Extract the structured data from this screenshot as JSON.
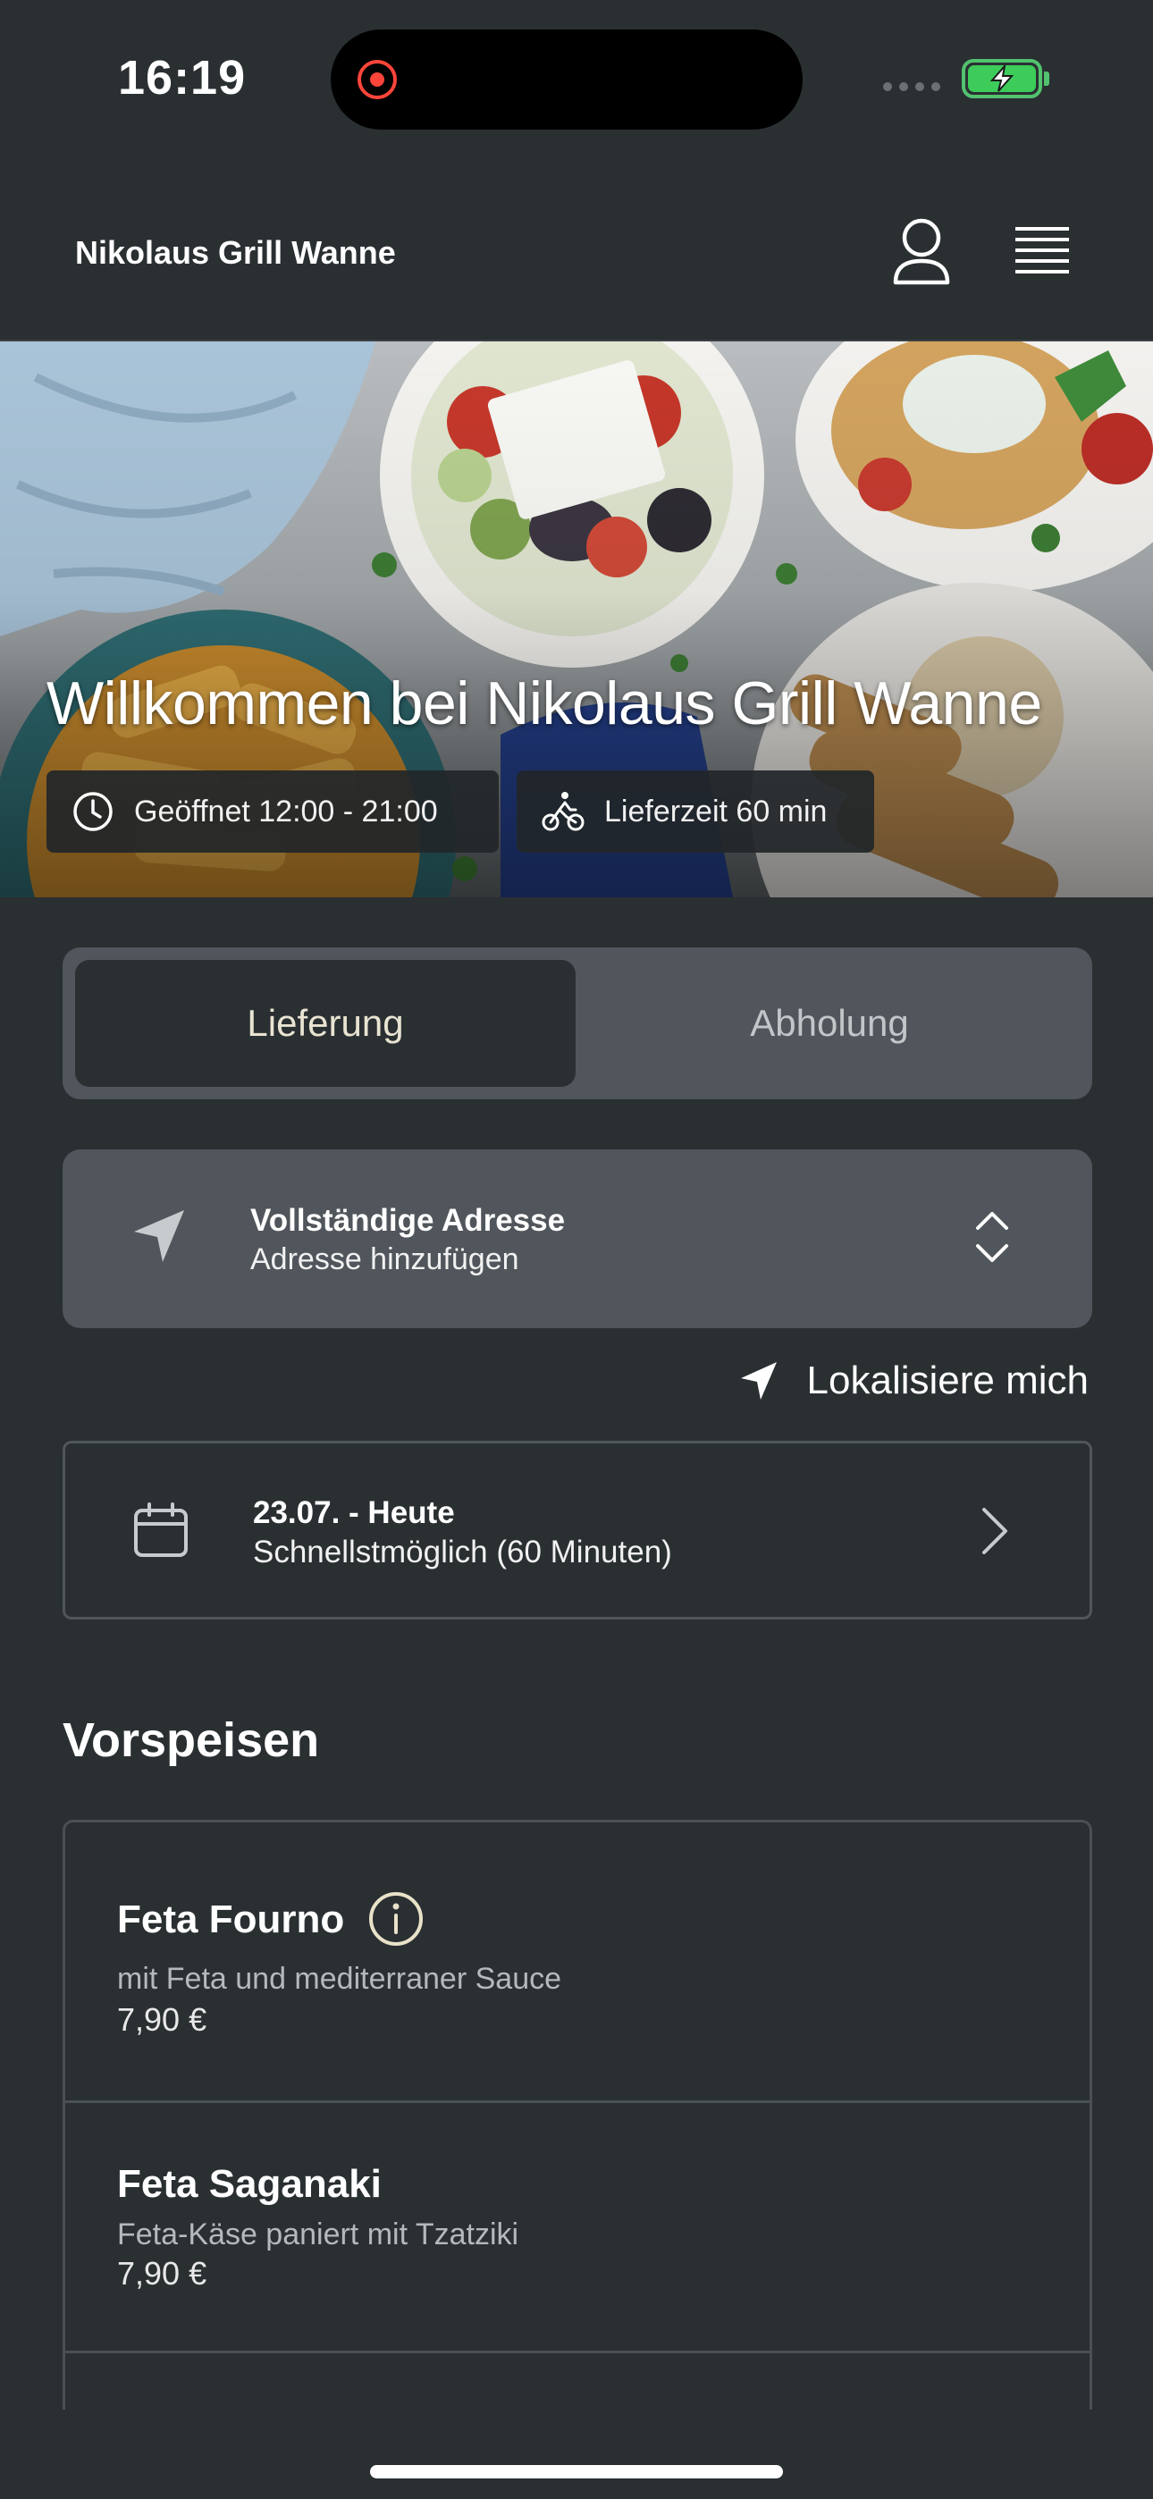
{
  "status_bar": {
    "time": "16:19"
  },
  "header": {
    "title": "Nikolaus Grill Wanne"
  },
  "hero": {
    "title": "Willkommen bei Nikolaus Grill Wanne",
    "opening_hours": "Geöffnet 12:00 - 21:00",
    "delivery_time": "Lieferzeit 60 min"
  },
  "order_mode": {
    "tabs": [
      "Lieferung",
      "Abholung"
    ],
    "selected": "Lieferung"
  },
  "address": {
    "title": "Vollständige Adresse",
    "placeholder": "Adresse hinzufügen"
  },
  "locate": {
    "label": "Lokalisiere mich"
  },
  "schedule": {
    "date": "23.07. - Heute",
    "time": "Schnellstmöglich (60 Minuten)"
  },
  "menu": {
    "section_title": "Vorspeisen",
    "items": [
      {
        "name": "Feta Fourno",
        "description": "mit Feta und mediterraner Sauce",
        "price": "7,90 €"
      },
      {
        "name": "Feta Saganaki",
        "description": "Feta-Käse paniert mit Tzatziki",
        "price": "7,90 €"
      }
    ]
  },
  "colors": {
    "background": "#2a2f32",
    "card": "#50565b",
    "active_tab_text": "#e9e4d2",
    "battery": "#3dcb5a",
    "record": "#ff453a"
  }
}
